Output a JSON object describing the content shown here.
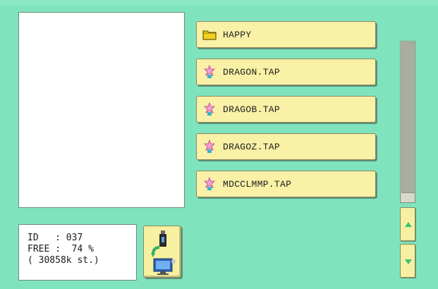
{
  "preview": {},
  "info": {
    "id_line": "ID   : 037",
    "free_line": "FREE :  74 %",
    "stitch_line": "( 30858k st.)"
  },
  "files": [
    {
      "name": "HAPPY",
      "icon": "folder-icon"
    },
    {
      "name": "DRAGON.TAP",
      "icon": "embroidery-file-icon"
    },
    {
      "name": "DRAGOB.TAP",
      "icon": "embroidery-file-icon"
    },
    {
      "name": "DRAGOZ.TAP",
      "icon": "embroidery-file-icon"
    },
    {
      "name": "MDCCLMMP.TAP",
      "icon": "embroidery-file-icon"
    }
  ],
  "usb_button": {
    "icon": "usb-to-screen-icon"
  },
  "scroll": {
    "up_icon": "arrow-up-icon",
    "down_icon": "arrow-down-icon"
  },
  "colors": {
    "background": "#7fe4be",
    "button_fill": "#f8f1a6",
    "scroll_arrow": "#3cbf7a",
    "folder": "#f4d21c"
  }
}
